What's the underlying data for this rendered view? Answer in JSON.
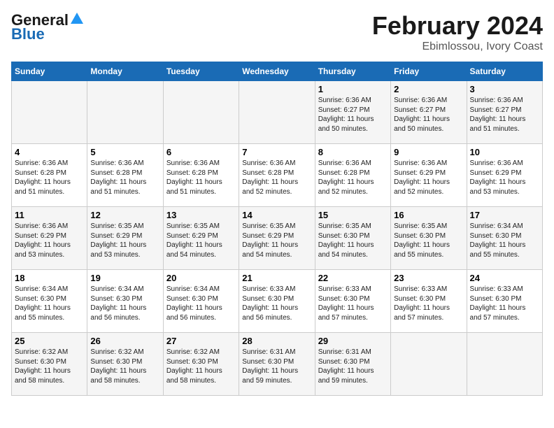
{
  "header": {
    "logo_general": "General",
    "logo_blue": "Blue",
    "month_title": "February 2024",
    "location": "Ebimlossou, Ivory Coast"
  },
  "days_of_week": [
    "Sunday",
    "Monday",
    "Tuesday",
    "Wednesday",
    "Thursday",
    "Friday",
    "Saturday"
  ],
  "weeks": [
    [
      {
        "day": "",
        "info": ""
      },
      {
        "day": "",
        "info": ""
      },
      {
        "day": "",
        "info": ""
      },
      {
        "day": "",
        "info": ""
      },
      {
        "day": "1",
        "info": "Sunrise: 6:36 AM\nSunset: 6:27 PM\nDaylight: 11 hours\nand 50 minutes."
      },
      {
        "day": "2",
        "info": "Sunrise: 6:36 AM\nSunset: 6:27 PM\nDaylight: 11 hours\nand 50 minutes."
      },
      {
        "day": "3",
        "info": "Sunrise: 6:36 AM\nSunset: 6:27 PM\nDaylight: 11 hours\nand 51 minutes."
      }
    ],
    [
      {
        "day": "4",
        "info": "Sunrise: 6:36 AM\nSunset: 6:28 PM\nDaylight: 11 hours\nand 51 minutes."
      },
      {
        "day": "5",
        "info": "Sunrise: 6:36 AM\nSunset: 6:28 PM\nDaylight: 11 hours\nand 51 minutes."
      },
      {
        "day": "6",
        "info": "Sunrise: 6:36 AM\nSunset: 6:28 PM\nDaylight: 11 hours\nand 51 minutes."
      },
      {
        "day": "7",
        "info": "Sunrise: 6:36 AM\nSunset: 6:28 PM\nDaylight: 11 hours\nand 52 minutes."
      },
      {
        "day": "8",
        "info": "Sunrise: 6:36 AM\nSunset: 6:28 PM\nDaylight: 11 hours\nand 52 minutes."
      },
      {
        "day": "9",
        "info": "Sunrise: 6:36 AM\nSunset: 6:29 PM\nDaylight: 11 hours\nand 52 minutes."
      },
      {
        "day": "10",
        "info": "Sunrise: 6:36 AM\nSunset: 6:29 PM\nDaylight: 11 hours\nand 53 minutes."
      }
    ],
    [
      {
        "day": "11",
        "info": "Sunrise: 6:36 AM\nSunset: 6:29 PM\nDaylight: 11 hours\nand 53 minutes."
      },
      {
        "day": "12",
        "info": "Sunrise: 6:35 AM\nSunset: 6:29 PM\nDaylight: 11 hours\nand 53 minutes."
      },
      {
        "day": "13",
        "info": "Sunrise: 6:35 AM\nSunset: 6:29 PM\nDaylight: 11 hours\nand 54 minutes."
      },
      {
        "day": "14",
        "info": "Sunrise: 6:35 AM\nSunset: 6:29 PM\nDaylight: 11 hours\nand 54 minutes."
      },
      {
        "day": "15",
        "info": "Sunrise: 6:35 AM\nSunset: 6:30 PM\nDaylight: 11 hours\nand 54 minutes."
      },
      {
        "day": "16",
        "info": "Sunrise: 6:35 AM\nSunset: 6:30 PM\nDaylight: 11 hours\nand 55 minutes."
      },
      {
        "day": "17",
        "info": "Sunrise: 6:34 AM\nSunset: 6:30 PM\nDaylight: 11 hours\nand 55 minutes."
      }
    ],
    [
      {
        "day": "18",
        "info": "Sunrise: 6:34 AM\nSunset: 6:30 PM\nDaylight: 11 hours\nand 55 minutes."
      },
      {
        "day": "19",
        "info": "Sunrise: 6:34 AM\nSunset: 6:30 PM\nDaylight: 11 hours\nand 56 minutes."
      },
      {
        "day": "20",
        "info": "Sunrise: 6:34 AM\nSunset: 6:30 PM\nDaylight: 11 hours\nand 56 minutes."
      },
      {
        "day": "21",
        "info": "Sunrise: 6:33 AM\nSunset: 6:30 PM\nDaylight: 11 hours\nand 56 minutes."
      },
      {
        "day": "22",
        "info": "Sunrise: 6:33 AM\nSunset: 6:30 PM\nDaylight: 11 hours\nand 57 minutes."
      },
      {
        "day": "23",
        "info": "Sunrise: 6:33 AM\nSunset: 6:30 PM\nDaylight: 11 hours\nand 57 minutes."
      },
      {
        "day": "24",
        "info": "Sunrise: 6:33 AM\nSunset: 6:30 PM\nDaylight: 11 hours\nand 57 minutes."
      }
    ],
    [
      {
        "day": "25",
        "info": "Sunrise: 6:32 AM\nSunset: 6:30 PM\nDaylight: 11 hours\nand 58 minutes."
      },
      {
        "day": "26",
        "info": "Sunrise: 6:32 AM\nSunset: 6:30 PM\nDaylight: 11 hours\nand 58 minutes."
      },
      {
        "day": "27",
        "info": "Sunrise: 6:32 AM\nSunset: 6:30 PM\nDaylight: 11 hours\nand 58 minutes."
      },
      {
        "day": "28",
        "info": "Sunrise: 6:31 AM\nSunset: 6:30 PM\nDaylight: 11 hours\nand 59 minutes."
      },
      {
        "day": "29",
        "info": "Sunrise: 6:31 AM\nSunset: 6:30 PM\nDaylight: 11 hours\nand 59 minutes."
      },
      {
        "day": "",
        "info": ""
      },
      {
        "day": "",
        "info": ""
      }
    ]
  ]
}
